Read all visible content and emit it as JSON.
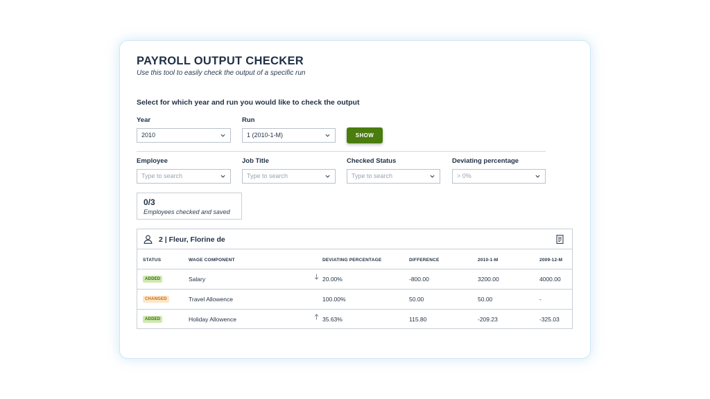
{
  "header": {
    "title": "PAYROLL OUTPUT CHECKER",
    "subtitle": "Use this tool to easily check the output of a specific run"
  },
  "selection": {
    "prompt": "Select for which year and run you would like to check the output",
    "year": {
      "label": "Year",
      "value": "2010"
    },
    "run": {
      "label": "Run",
      "value": "1 (2010-1-M)"
    },
    "show_label": "SHOW"
  },
  "filters": {
    "employee": {
      "label": "Employee",
      "placeholder": "Type to search"
    },
    "job_title": {
      "label": "Job Title",
      "placeholder": "Type to search"
    },
    "checked_status": {
      "label": "Checked Status",
      "placeholder": "Type to search"
    },
    "deviating_percentage": {
      "label": "Deviating percentage",
      "placeholder": "> 0%"
    }
  },
  "counter": {
    "value": "0/3",
    "text": "Employees checked and saved"
  },
  "employee_panel": {
    "name": "2 | Fleur, Florine de",
    "columns": [
      "STATUS",
      "WAGE COMPONENT",
      "DEVIATING PERCENTAGE",
      "DIFFERENCE",
      "2010-1-M",
      "2009-12-M"
    ],
    "rows": [
      {
        "status": "ADDED",
        "component": "Salary",
        "trend": "down",
        "deviation": "20.00%",
        "difference": "-800.00",
        "current": "3200.00",
        "previous": "4000.00"
      },
      {
        "status": "CHANGED",
        "component": "Travel Allowence",
        "trend": "",
        "deviation": "100.00%",
        "difference": "50.00",
        "current": "50.00",
        "previous": "-"
      },
      {
        "status": "ADDED",
        "component": "Holiday Allowence",
        "trend": "up",
        "deviation": "35.63%",
        "difference": "115.80",
        "current": "-209.23",
        "previous": "-325.03"
      }
    ]
  },
  "icons": {
    "person": "person-icon",
    "document": "document-icon",
    "chevron": "chevron-down-icon",
    "arrow_down": "arrow-down-icon",
    "arrow_up": "arrow-up-icon"
  },
  "colors": {
    "accent": "#4a7c0f",
    "added_badge": "#cfe8b0",
    "changed_badge": "#fde6c8",
    "card_border": "#cfe6f3",
    "text": "#1f2f44"
  }
}
